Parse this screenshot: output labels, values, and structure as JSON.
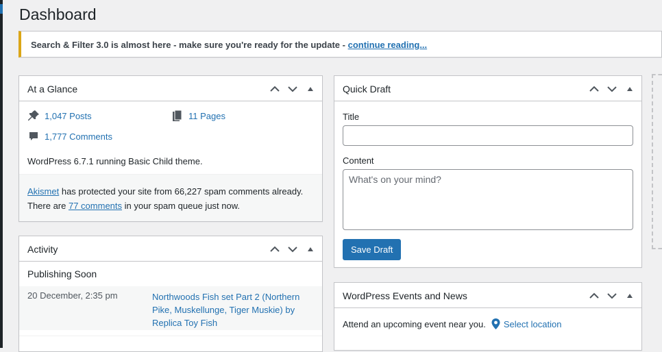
{
  "page": {
    "title": "Dashboard"
  },
  "notice": {
    "text": "Search & Filter 3.0 is almost here - make sure you're ready for the update - ",
    "link": "continue reading..."
  },
  "glance": {
    "title": "At a Glance",
    "posts": "1,047 Posts",
    "pages": "11 Pages",
    "comments": "1,777 Comments",
    "version": "WordPress 6.7.1 running Basic Child theme.",
    "akismet_link": "Akismet",
    "akismet_text": " has protected your site from 66,227 spam comments already.",
    "spam_prefix": "There are ",
    "spam_link": "77 comments",
    "spam_suffix": " in your spam queue just now."
  },
  "activity": {
    "title": "Activity",
    "publishing_soon": "Publishing Soon",
    "items": [
      {
        "date": "20 December, 2:35 pm",
        "title": "Northwoods Fish set Part 2 (Northern Pike, Muskellunge, Tiger Muskie) by Replica Toy Fish"
      }
    ]
  },
  "quick_draft": {
    "title": "Quick Draft",
    "title_label": "Title",
    "title_value": "",
    "content_label": "Content",
    "content_placeholder": "What's on your mind?",
    "save_label": "Save Draft"
  },
  "events": {
    "title": "WordPress Events and News",
    "attend_text": "Attend an upcoming event near you.",
    "select_location": "Select location"
  },
  "colors": {
    "accent": "#2271b1",
    "notice_border": "#dba617",
    "background": "#f0f0f1"
  },
  "icons": {
    "handles": [
      "chevron-up-icon",
      "chevron-down-icon",
      "triangle-up-icon"
    ],
    "posts": "pin-icon",
    "pages": "pages-icon",
    "comments": "comment-icon",
    "location": "location-pin-icon"
  }
}
